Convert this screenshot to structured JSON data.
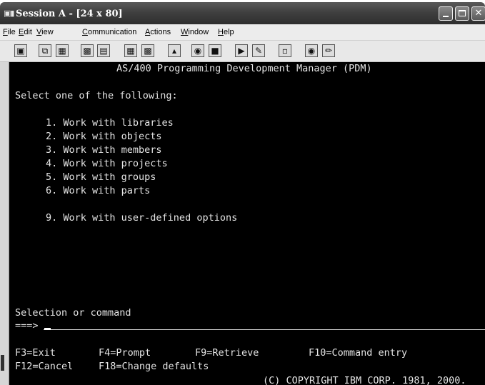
{
  "window": {
    "title": "Session A - [24 x 80]"
  },
  "menu": [
    {
      "label": "File",
      "acc": "F",
      "rest": "ile"
    },
    {
      "label": "Edit",
      "acc": "E",
      "rest": "dit"
    },
    {
      "label": "View",
      "acc": "V",
      "rest": "iew"
    },
    {
      "label": "Communication",
      "acc": "C",
      "rest": "ommunication"
    },
    {
      "label": "Actions",
      "acc": "A",
      "rest": "ctions"
    },
    {
      "label": "Window",
      "acc": "W",
      "rest": "indow"
    },
    {
      "label": "Help",
      "acc": "H",
      "rest": "elp"
    }
  ],
  "toolbar": [
    "print-screen-icon",
    "copy-icon",
    "paste-icon",
    "send-file-icon",
    "receive-file-icon",
    "display-icon",
    "keypad-icon",
    "macro-icon",
    "record-macro-icon",
    "stop-macro-icon",
    "play-macro-icon",
    "edit-macro-icon",
    "clipboard-icon",
    "web-icon",
    "edit-pen-icon"
  ],
  "screen": {
    "title": "AS/400 Programming Development Manager (PDM)",
    "instruction": "Select one of the following:",
    "options": [
      "1. Work with libraries",
      "2. Work with objects",
      "3. Work with members",
      "4. Work with projects",
      "5. Work with groups",
      "6. Work with parts"
    ],
    "extra_option": "9. Work with user-defined options",
    "selection_label": "Selection or command",
    "prompt": "===>",
    "fkeys_row1": [
      "F3=Exit",
      "F4=Prompt",
      "F9=Retrieve",
      "F10=Command entry"
    ],
    "fkeys_row2": [
      "F12=Cancel",
      "F18=Change defaults"
    ],
    "copyright": "(C) COPYRIGHT IBM CORP. 1981, 2000."
  }
}
